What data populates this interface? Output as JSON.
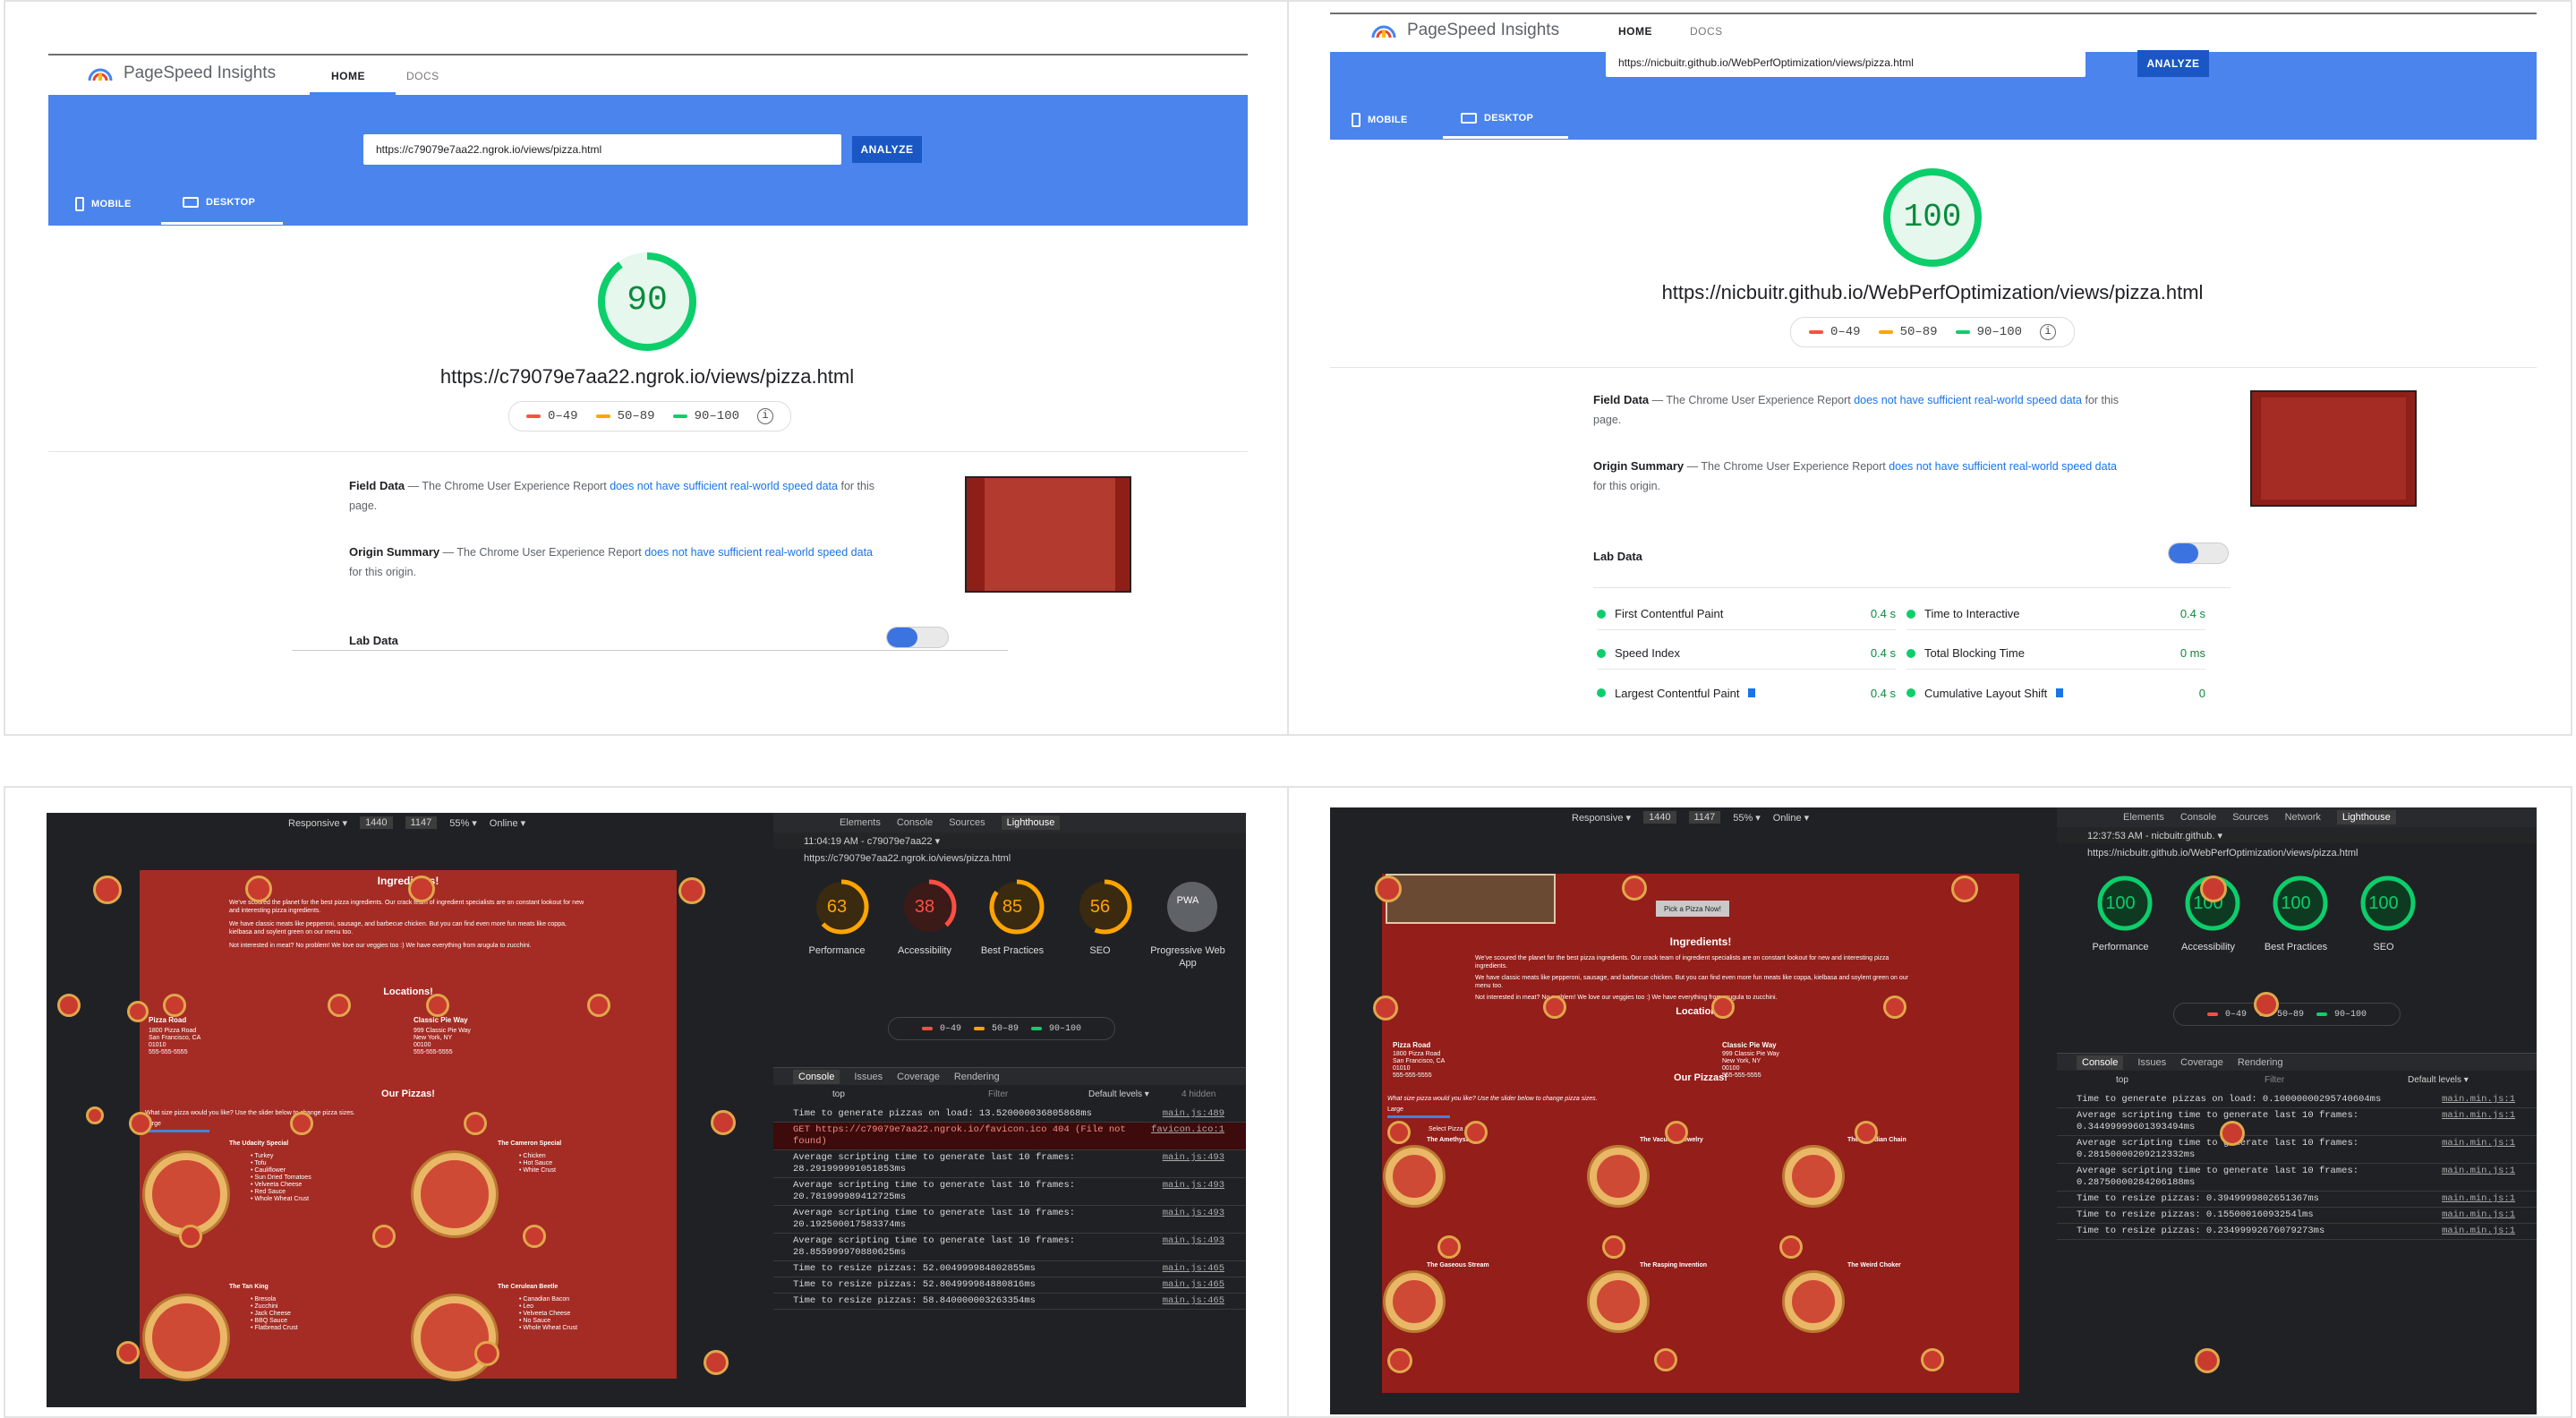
{
  "colors": {
    "blue_bar": "#4a84ec",
    "good": "#0cce6b",
    "avg": "#ffa400",
    "bad": "#ff4e42",
    "pizza_bg": "#a42c24",
    "devtools_bg": "#202124"
  },
  "psi": {
    "brand": "PageSpeed Insights",
    "nav_home": "HOME",
    "nav_docs": "DOCS",
    "analyze": "ANALYZE",
    "mobile": "MOBILE",
    "desktop": "DESKTOP",
    "legend": [
      "0–49",
      "50–89",
      "90–100"
    ],
    "field_data": "Field Data",
    "origin_summary": "Origin Summary",
    "report_prefix": "— The Chrome User Experience Report",
    "report_link": "does not have sufficient real-world speed data",
    "field_suffix": "for this page.",
    "origin_suffix": "for this origin.",
    "lab_data": "Lab Data"
  },
  "left_report": {
    "url": "https://c79079e7aa22.ngrok.io/views/pizza.html",
    "score": 90
  },
  "right_report": {
    "url": "https://nicbuitr.github.io/WebPerfOptimization/views/pizza.html",
    "score": 100,
    "metrics": [
      {
        "name": "First Contentful Paint",
        "value": "0.4 s"
      },
      {
        "name": "Time to Interactive",
        "value": "0.4 s"
      },
      {
        "name": "Speed Index",
        "value": "0.4 s"
      },
      {
        "name": "Total Blocking Time",
        "value": "0 ms"
      },
      {
        "name": "Largest Contentful Paint",
        "value": "0.4 s"
      },
      {
        "name": "Cumulative Layout Shift",
        "value": "0"
      }
    ]
  },
  "devtools_left": {
    "device": "Responsive ▾",
    "width": "1440",
    "height": "1147",
    "zoom": "55% ▾",
    "network": "Online ▾",
    "tabs": [
      "Elements",
      "Console",
      "Sources",
      "Lighthouse"
    ],
    "report_time": "11:04:19 AM - c79079e7aa22 ▾",
    "report_url": "https://c79079e7aa22.ngrok.io/views/pizza.html",
    "gauges": [
      {
        "score": "63",
        "label": "Performance",
        "color": "#ffa400",
        "pct": 0.63
      },
      {
        "score": "38",
        "label": "Accessibility",
        "color": "#ff4e42",
        "pct": 0.38
      },
      {
        "score": "85",
        "label": "Best Practices",
        "color": "#ffa400",
        "pct": 0.85
      },
      {
        "score": "56",
        "label": "SEO",
        "color": "#ffa400",
        "pct": 0.56
      },
      {
        "score": "PWA",
        "label": "Progressive Web App",
        "color": "#ddd",
        "pct": 0
      }
    ],
    "drawer_tabs": [
      "Console",
      "Issues",
      "Coverage",
      "Rendering"
    ],
    "context": "top",
    "filter": "Filter",
    "levels": "Default levels ▾",
    "hidden": "4 hidden",
    "console": [
      {
        "text": "Time to generate pizzas on load: 13.520000036805868ms",
        "src": "main.js:489",
        "err": false
      },
      {
        "text": "GET https://c79079e7aa22.ngrok.io/favicon.ico 404 (File not found)",
        "src": "favicon.ico:1",
        "err": true
      },
      {
        "text": "Average scripting time to generate last 10 frames: 28.291999991051853ms",
        "src": "main.js:493",
        "err": false
      },
      {
        "text": "Average scripting time to generate last 10 frames: 20.781999989412725ms",
        "src": "main.js:493",
        "err": false
      },
      {
        "text": "Average scripting time to generate last 10 frames: 20.192500017583374ms",
        "src": "main.js:493",
        "err": false
      },
      {
        "text": "Average scripting time to generate last 10 frames: 28.855999970880625ms",
        "src": "main.js:493",
        "err": false
      },
      {
        "text": "Time to resize pizzas: 52.004999984802855ms",
        "src": "main.js:465",
        "err": false
      },
      {
        "text": "Time to resize pizzas: 52.804999984880816ms",
        "src": "main.js:465",
        "err": false
      },
      {
        "text": "Time to resize pizzas: 58.840000003263354ms",
        "src": "main.js:465",
        "err": false
      }
    ],
    "page": {
      "ingredients_title": "Ingredients!",
      "p1": "We've scoured the planet for the best pizza ingredients. Our crack team of ingredient specialists are on constant lookout for new and interesting pizza ingredients.",
      "p2": "We have classic meats like pepperoni, sausage, and barbecue chicken. But you can find even more fun meats like coppa, kielbasa and soylent green on our menu too.",
      "p3": "Not interested in meat? No problem! We love our veggies too :) We have everything from arugula to zucchini.",
      "locations_title": "Locations!",
      "loc1_name": "Pizza Road",
      "loc1_addr": "1800 Pizza Road\nSan Francisco, CA\n01010\n555-555-5555",
      "loc2_name": "Classic Pie Way",
      "loc2_addr": "999 Classic Pie Way\nNew York, NY\n00100\n555-555-5555",
      "pizzas_title": "Our Pizzas!",
      "slider_text": "What size pizza would you like? Use the slider below to change pizza sizes.",
      "size": "Large",
      "pz1": "The Udacity Special",
      "pz1_items": "• Turkey\n• Tofu\n• Cauliflower\n• Sun Dried Tomatoes\n• Velveeta Cheese\n• Red Sauce\n• Whole Wheat Crust",
      "pz2": "The Cameron Special",
      "pz2_items": "• Chicken\n• Hot Sauce\n• White Crust",
      "pz3": "The Tan King",
      "pz3_items": "• Bresola\n• Zucchini\n• Jack Cheese\n• BBQ Sauce\n• Flatbread Crust",
      "pz4": "The Cerulean Beetle",
      "pz4_items": "• Canadian Bacon\n• Leo\n• Velveeta Cheese\n• No Sauce\n• Whole Wheat Crust"
    }
  },
  "devtools_right": {
    "device": "Responsive ▾",
    "width": "1440",
    "height": "1147",
    "zoom": "55% ▾",
    "network": "Online ▾",
    "tabs": [
      "Elements",
      "Console",
      "Sources",
      "Network",
      "Lighthouse"
    ],
    "report_time": "12:37:53 AM - nicbuitr.github. ▾",
    "report_url": "https://nicbuitr.github.io/WebPerfOptimization/views/pizza.html",
    "gauges": [
      {
        "score": "100",
        "label": "Performance"
      },
      {
        "score": "100",
        "label": "Accessibility"
      },
      {
        "score": "100",
        "label": "Best Practices"
      },
      {
        "score": "100",
        "label": "SEO"
      }
    ],
    "drawer_tabs": [
      "Console",
      "Issues",
      "Coverage",
      "Rendering"
    ],
    "context": "top",
    "filter": "Filter",
    "levels": "Default levels ▾",
    "console": [
      {
        "text": "Time to generate pizzas on load: 0.10000000295740604ms",
        "src": "main.min.js:1"
      },
      {
        "text": "Average scripting time to generate last 10 frames: 0.34499999601393494ms",
        "src": "main.min.js:1"
      },
      {
        "text": "Average scripting time to generate last 10 frames: 0.28150000209212332ms",
        "src": "main.min.js:1"
      },
      {
        "text": "Average scripting time to generate last 10 frames: 0.28750000284206188ms",
        "src": "main.min.js:1"
      },
      {
        "text": "Time to resize pizzas: 0.3949999802651367ms",
        "src": "main.min.js:1"
      },
      {
        "text": "Time to resize pizzas: 0.15500016093254lms",
        "src": "main.min.js:1"
      },
      {
        "text": "Time to resize pizzas: 0.23499992676079273ms",
        "src": "main.min.js:1"
      }
    ],
    "page": {
      "pick": "Pick a Pizza Now!",
      "loc1_name": "Pizza Road",
      "loc2_name": "Classic Pie Way",
      "ingredients_title": "Ingredients!",
      "locations_title": "Locations!",
      "pizzas_title": "Our Pizzas!",
      "slider_text": "What size pizza would you like? Use the slider below to change pizza sizes.",
      "size": "Large",
      "select": "Select Pizza Size",
      "pz1": "The Amethyst Devil",
      "pz2": "The Vacuous Jewelry",
      "pz3": "The Obsidian Chain",
      "pz4": "The Gaseous Stream",
      "pz5": "The Rasping Invention",
      "pz6": "The Weird Choker"
    }
  }
}
